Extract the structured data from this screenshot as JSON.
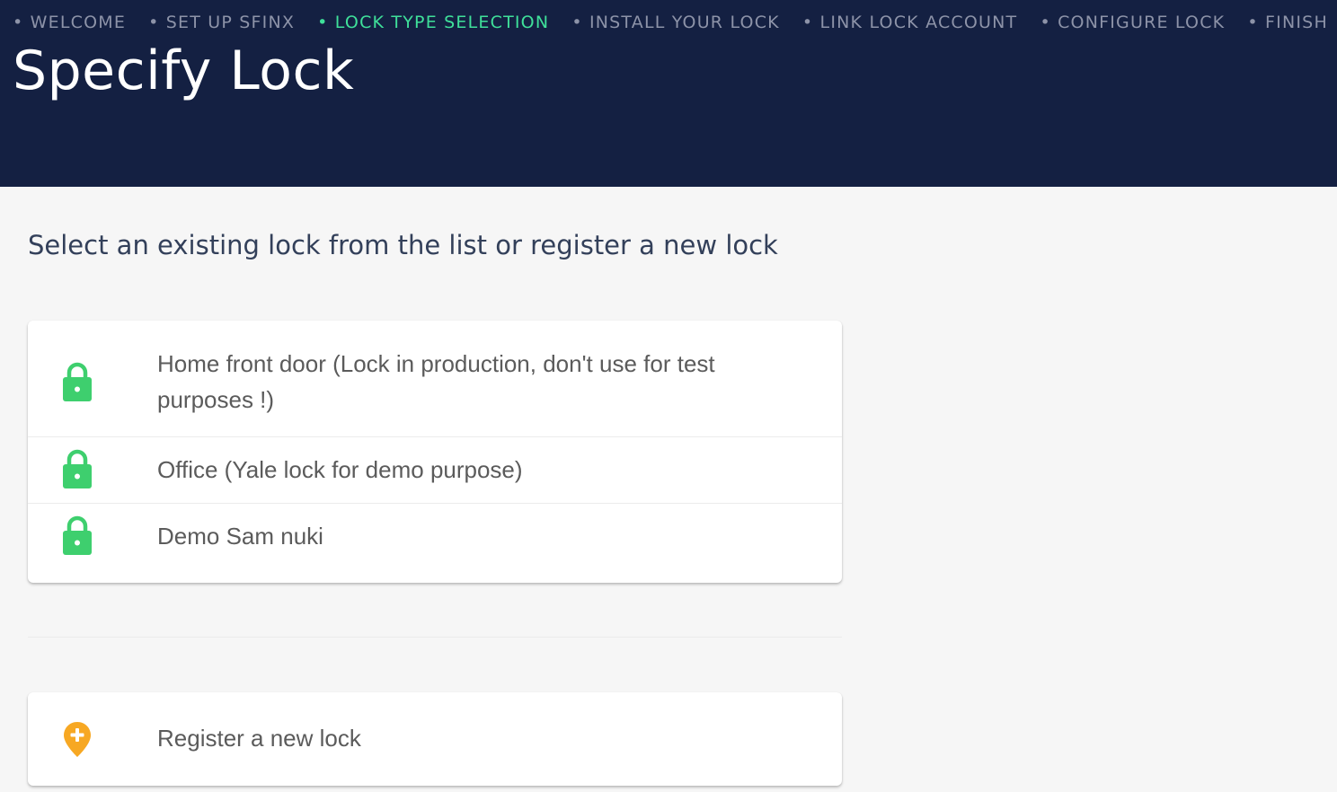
{
  "header": {
    "steps": [
      "• WELCOME",
      "• SET UP SFINX",
      "• LOCK TYPE SELECTION",
      "• INSTALL YOUR LOCK",
      "• LINK LOCK ACCOUNT",
      "• CONFIGURE LOCK",
      "• FINISH"
    ],
    "active_step": "LOCK TYPE SELECTION",
    "title": "Specify Lock"
  },
  "main": {
    "subtitle": "Select an existing lock from the list or register a new lock",
    "locks": [
      {
        "label": "Home front door (Lock in production, don't use for test purposes !)",
        "icon": "lock-icon"
      },
      {
        "label": "Office (Yale lock for demo purpose)",
        "icon": "lock-icon"
      },
      {
        "label": "Demo Sam nuki",
        "icon": "lock-icon"
      }
    ],
    "register": {
      "label": "Register a new lock",
      "icon": "add-location-icon"
    }
  },
  "colors": {
    "header_bg": "#142042",
    "active_step": "#3fe09a",
    "inactive_step": "#8d93a8",
    "lock_icon": "#3ecf6e",
    "register_icon": "#f7a823"
  }
}
